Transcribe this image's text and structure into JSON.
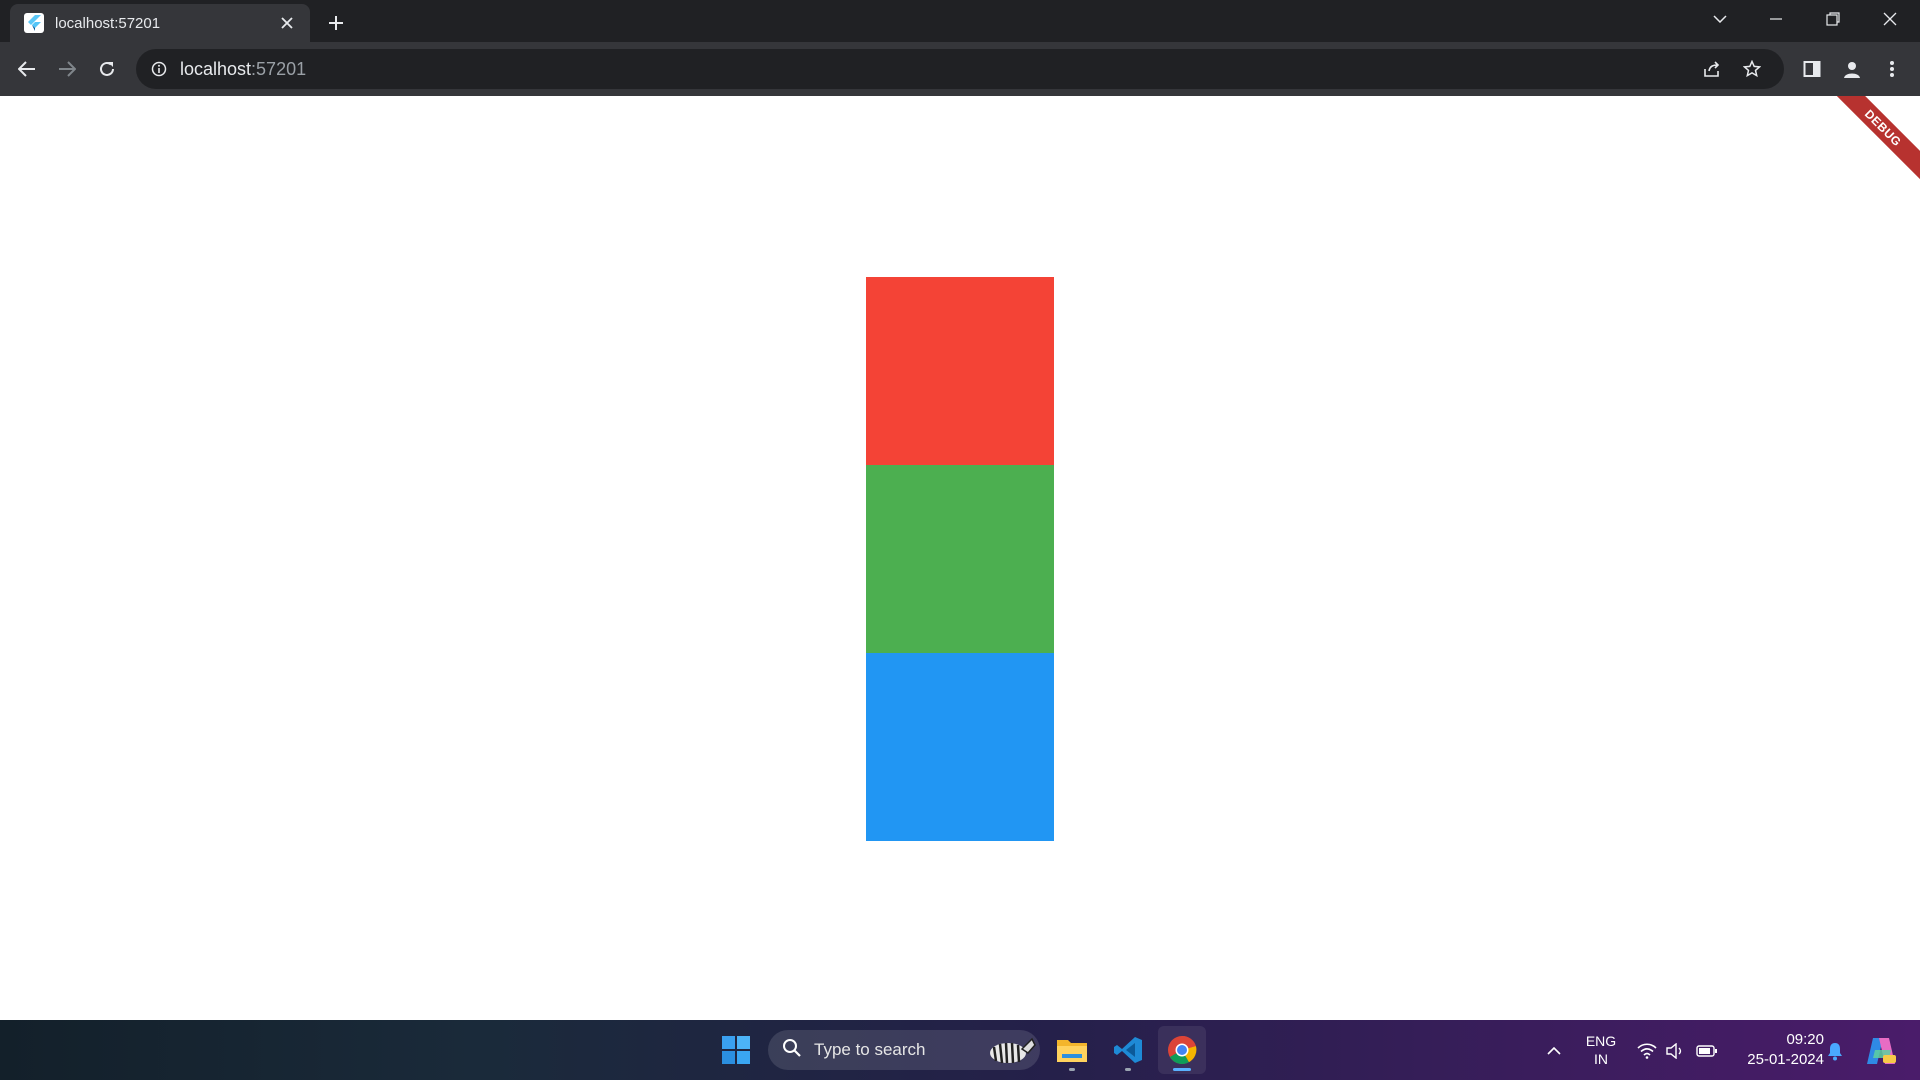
{
  "browser": {
    "tab": {
      "title": "localhost:57201"
    },
    "address_bar": {
      "host": "localhost",
      "port": ":57201"
    }
  },
  "page": {
    "debug_banner": "DEBUG",
    "boxes": [
      {
        "name": "red",
        "color": "#f44336"
      },
      {
        "name": "green",
        "color": "#4caf50"
      },
      {
        "name": "blue",
        "color": "#2196f3"
      }
    ]
  },
  "taskbar": {
    "search_placeholder": "Type to search",
    "language": {
      "line1": "ENG",
      "line2": "IN"
    },
    "clock": {
      "time": "09:20",
      "date": "25-01-2024"
    }
  }
}
